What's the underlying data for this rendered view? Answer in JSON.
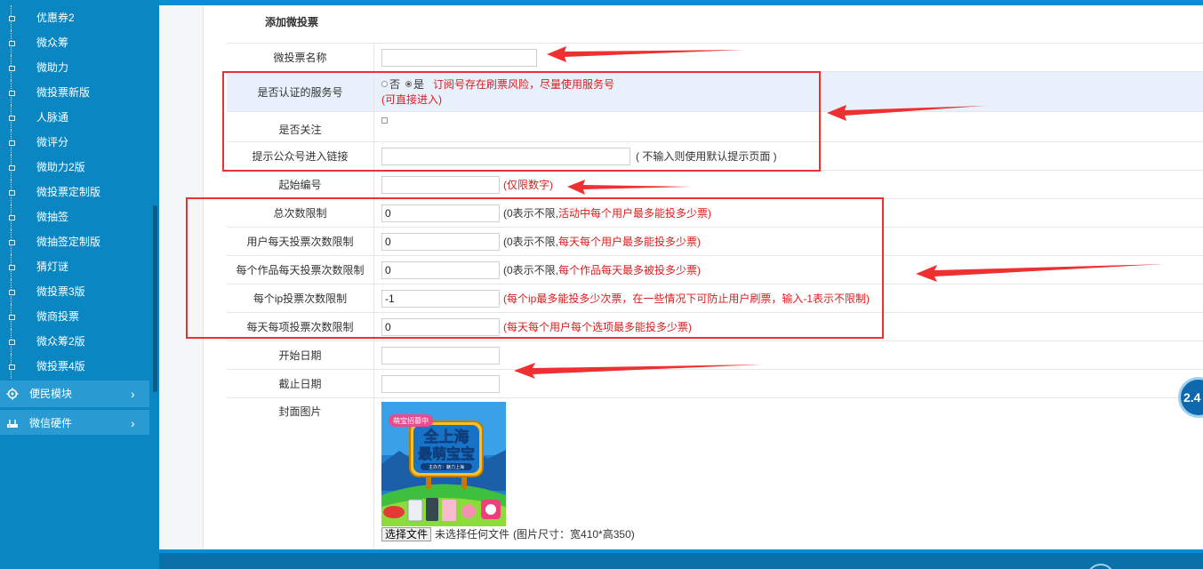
{
  "sidebar": {
    "sub_items": [
      "优惠券2",
      "微众筹",
      "微助力",
      "微投票新版",
      "人脉通",
      "微评分",
      "微助力2版",
      "微投票定制版",
      "微抽签",
      "微抽签定制版",
      "猜灯谜",
      "微投票3版",
      "微商投票",
      "微众筹2版",
      "微投票4版"
    ],
    "modules": [
      {
        "label": "便民模块",
        "icon": "gear-icon"
      },
      {
        "label": "微信硬件",
        "icon": "router-icon"
      }
    ]
  },
  "form": {
    "title": "添加微投票",
    "name_label": "微投票名称",
    "name_value": "",
    "certified_label": "是否认证的服务号",
    "certified_options": [
      "否",
      "是"
    ],
    "certified_selected": "是",
    "certified_hint": "订阅号存在刷票风险，尽量使用服务号",
    "certified_hint2": "(可直接进入)",
    "follow_label": "是否关注",
    "follow_link_label": "提示公众号进入链接",
    "follow_link_value": "",
    "follow_link_hint": "( 不输入则使用默认提示页面 )",
    "start_no_label": "起始编号",
    "start_no_value": "",
    "start_no_hint": "(仅限数字)",
    "total_limit_label": "总次数限制",
    "total_limit_value": "0",
    "total_limit_hint_a": "(0表示不限,",
    "total_limit_hint_b": "活动中每个用户最多能投多少票)",
    "user_daily_label": "用户每天投票次数限制",
    "user_daily_value": "0",
    "user_daily_hint_a": "(0表示不限,",
    "user_daily_hint_b": "每天每个用户最多能投多少票)",
    "work_daily_label": "每个作品每天投票次数限制",
    "work_daily_value": "0",
    "work_daily_hint_a": "(0表示不限,",
    "work_daily_hint_b": "每个作品每天最多被投多少票)",
    "ip_label": "每个ip投票次数限制",
    "ip_value": "-1",
    "ip_hint": "(每个ip最多能投多少次票，在一些情况下可防止用户刷票，输入-1表示不限制)",
    "item_daily_label": "每天每项投票次数限制",
    "item_daily_value": "0",
    "item_daily_hint": "(每天每个用户每个选项最多能投多少票)",
    "start_date_label": "开始日期",
    "start_date_value": "",
    "end_date_label": "截止日期",
    "end_date_value": "",
    "cover_label": "封面图片",
    "cover_image_text_top": "萌宝招募中",
    "cover_image_text_1": "全上海",
    "cover_image_text_2": "最萌宝宝",
    "cover_image_text_3": "主办方：魅力上海",
    "file_button": "选择文件",
    "file_status": "未选择任何文件",
    "file_hint": "(图片尺寸：宽410*高350)"
  },
  "badge_text": "2.4",
  "colors": {
    "accent": "#0a86c2",
    "annotation": "#ee3030",
    "hint_red": "#d81e1e"
  }
}
